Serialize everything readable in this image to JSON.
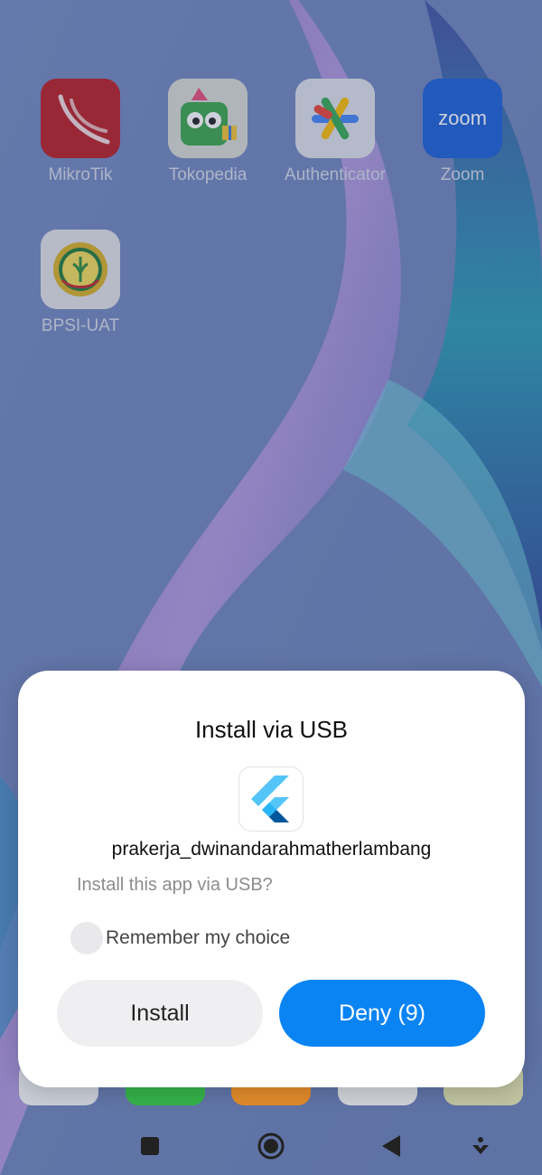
{
  "home": {
    "apps": [
      {
        "label": "MikroTik",
        "icon": "mikrotik-icon"
      },
      {
        "label": "Tokopedia",
        "icon": "tokopedia-icon"
      },
      {
        "label": "Authenticator",
        "icon": "authenticator-icon"
      },
      {
        "label": "Zoom",
        "icon": "zoom-icon",
        "icon_text": "zoom"
      },
      {
        "label": "BPSI-UAT",
        "icon": "bpsi-uat-icon"
      }
    ]
  },
  "dialog": {
    "title": "Install via USB",
    "app_icon": "flutter-icon",
    "package_name": "prakerja_dwinandarahmatherlambang",
    "prompt": "Install this app via USB?",
    "remember_label": "Remember my choice",
    "remember_checked": false,
    "install_label": "Install",
    "deny_label": "Deny (9)",
    "colors": {
      "deny": "#0b84f3",
      "install": "#efeff1"
    }
  },
  "navbar": {
    "buttons": [
      "recents-square-icon",
      "home-circle-icon",
      "back-triangle-icon",
      "assistant-icon"
    ]
  }
}
